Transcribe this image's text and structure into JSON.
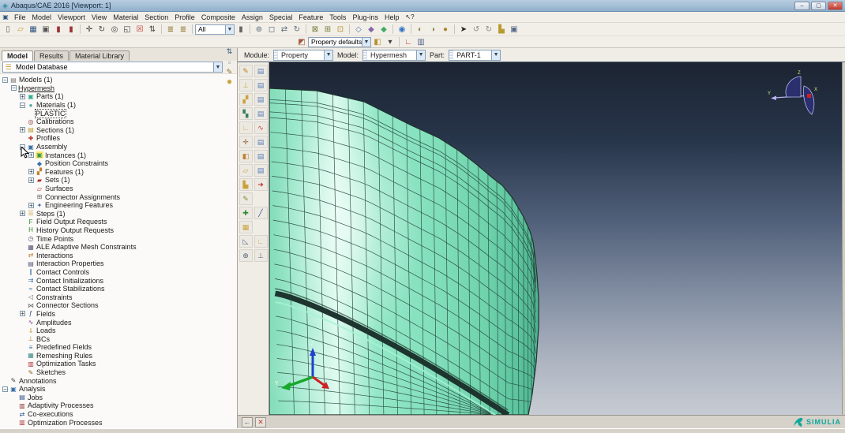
{
  "window": {
    "title": "Abaqus/CAE 2016 [Viewport: 1]",
    "controls": [
      {
        "n": "minimize-button",
        "g": "–"
      },
      {
        "n": "restore-button",
        "g": "▢"
      },
      {
        "n": "close-button",
        "g": "✕"
      }
    ]
  },
  "menu": {
    "items": [
      "File",
      "Model",
      "Viewport",
      "View",
      "Material",
      "Section",
      "Profile",
      "Composite",
      "Assign",
      "Special",
      "Feature",
      "Tools",
      "Plug-ins",
      "Help"
    ],
    "context_help_glyph": "↖?"
  },
  "toolbar_main": {
    "selection_filter_value": "All",
    "icons": [
      {
        "t": "i",
        "n": "new-file-icon",
        "g": "▯",
        "c": "#6b6b6b"
      },
      {
        "t": "i",
        "n": "open-folder-icon",
        "g": "▱",
        "c": "#c8973a"
      },
      {
        "t": "i",
        "n": "save-icon",
        "g": "▦",
        "c": "#33567f"
      },
      {
        "t": "i",
        "n": "print-icon",
        "g": "▣",
        "c": "#555555"
      },
      {
        "t": "i",
        "n": "red-stamp-icon-1",
        "g": "▮",
        "c": "#9c3333"
      },
      {
        "t": "i",
        "n": "red-stamp-icon-2",
        "g": "▮",
        "c": "#9c3333"
      },
      {
        "t": "s"
      },
      {
        "t": "i",
        "n": "pan-view-icon",
        "g": "✛",
        "c": "#444444"
      },
      {
        "t": "i",
        "n": "rotate-view-icon",
        "g": "↻",
        "c": "#444444"
      },
      {
        "t": "i",
        "n": "magnify-view-icon",
        "g": "◎",
        "c": "#444444"
      },
      {
        "t": "i",
        "n": "box-zoom-icon",
        "g": "◱",
        "c": "#444444"
      },
      {
        "t": "i",
        "n": "fit-view-icon",
        "g": "☒",
        "c": "#c23b2f"
      },
      {
        "t": "i",
        "n": "cycle-views-icon",
        "g": "⇅",
        "c": "#444444"
      },
      {
        "t": "s"
      },
      {
        "t": "i",
        "n": "measure-icon-1",
        "g": "≣",
        "c": "#8a6a22"
      },
      {
        "t": "i",
        "n": "measure-icon-2",
        "g": "≣",
        "c": "#8a6a22"
      },
      {
        "t": "s"
      },
      {
        "t": "c",
        "n": "selection-filter-combo",
        "p": "toolbar_main.selection_filter_value",
        "w": 50
      },
      {
        "t": "i",
        "n": "selection-options-icon",
        "g": "▮",
        "c": "#666666"
      },
      {
        "t": "s"
      },
      {
        "t": "i",
        "n": "group-circle-icon",
        "g": "⊚",
        "c": "#5a6a7a"
      },
      {
        "t": "i",
        "n": "outline-box-icon",
        "g": "◻",
        "c": "#5a6a7a"
      },
      {
        "t": "i",
        "n": "translate-tool-icon",
        "g": "⇄",
        "c": "#5a6a7a"
      },
      {
        "t": "i",
        "n": "rotate-tool-icon",
        "g": "↻",
        "c": "#5a6a7a"
      },
      {
        "t": "s"
      },
      {
        "t": "i",
        "n": "wireframe-render-icon",
        "g": "⊠",
        "c": "#7a7a33"
      },
      {
        "t": "i",
        "n": "hidden-render-icon",
        "g": "⊞",
        "c": "#7a7a33"
      },
      {
        "t": "i",
        "n": "shaded-render-icon",
        "g": "⊡",
        "c": "#b8912f"
      },
      {
        "t": "s"
      },
      {
        "t": "i",
        "n": "wire-cube-icon",
        "g": "◇",
        "c": "#5577aa"
      },
      {
        "t": "i",
        "n": "hidden-cube-icon",
        "g": "◆",
        "c": "#8866aa"
      },
      {
        "t": "i",
        "n": "shaded-cube-icon",
        "g": "◆",
        "c": "#44aa66"
      },
      {
        "t": "s"
      },
      {
        "t": "i",
        "n": "info-icon",
        "g": "◉",
        "c": "#2e6fc0"
      },
      {
        "t": "s"
      },
      {
        "t": "i",
        "n": "view-cut-icon-1",
        "g": "◐",
        "c": "#998844"
      },
      {
        "t": "i",
        "n": "view-cut-icon-2",
        "g": "◑",
        "c": "#998844"
      },
      {
        "t": "i",
        "n": "sphere-icon",
        "g": "●",
        "c": "#aa8833"
      },
      {
        "t": "s"
      },
      {
        "t": "i",
        "n": "pointer-icon",
        "g": "➤",
        "c": "#222222"
      },
      {
        "t": "i",
        "n": "undo-icon",
        "g": "↺",
        "c": "#888888"
      },
      {
        "t": "i",
        "n": "redo-icon",
        "g": "↻",
        "c": "#888888"
      },
      {
        "t": "i",
        "n": "datum-corner-icon",
        "g": "▙",
        "c": "#b89a2f"
      },
      {
        "t": "i",
        "n": "viewport-window-icon",
        "g": "▣",
        "c": "#556688"
      }
    ]
  },
  "toolbar_secondary": {
    "color_code_value": "Property defaults",
    "icons": [
      {
        "t": "i",
        "n": "color-code-palette-icon",
        "g": "◩",
        "c": "#a05a3a"
      },
      {
        "t": "c",
        "n": "color-code-combo",
        "p": "toolbar_secondary.color_code_value",
        "w": 80
      },
      {
        "t": "i",
        "n": "color-cube-icon",
        "g": "◧",
        "c": "#b8912f"
      },
      {
        "t": "i",
        "n": "color-cube-dropdown-icon",
        "g": "▾",
        "c": "#444444"
      },
      {
        "t": "s"
      },
      {
        "t": "i",
        "n": "datum-axes-icon",
        "g": "∟",
        "c": "#c23b2f"
      },
      {
        "t": "i",
        "n": "view-options-icon",
        "g": "▥",
        "c": "#556688"
      }
    ]
  },
  "context_bar": {
    "module_label": "Module:",
    "module_value": "Property",
    "model_label": "Model:",
    "model_value": "Hypermesh",
    "part_label": "Part:",
    "part_value": "PART-1"
  },
  "left_panel": {
    "tabs": [
      {
        "label": "Model"
      },
      {
        "label": "Results"
      },
      {
        "label": "Material Library"
      }
    ],
    "database_combo_value": "Model Database",
    "db_buttons": [
      {
        "n": "expand-tree-icon",
        "g": "⇅",
        "c": "#33567f"
      },
      {
        "n": "filter-box-icon",
        "g": "▫",
        "c": "#777777"
      },
      {
        "n": "edit-pencil-icon",
        "g": "✎",
        "c": "#8a6a22"
      },
      {
        "n": "tips-icon",
        "g": "✹",
        "c": "#caa23a"
      }
    ],
    "tree": [
      {
        "l": "Models (1)",
        "d": 0,
        "e": "-",
        "g": "▤",
        "c": "#7a7a7a",
        "n": "models"
      },
      {
        "l": "Hypermesh",
        "d": 1,
        "e": "-",
        "g": "",
        "c": "",
        "n": "model-hypermesh",
        "f": "u"
      },
      {
        "l": "Parts (1)",
        "d": 2,
        "e": "+",
        "g": "▣",
        "c": "#2fa98c",
        "n": "parts"
      },
      {
        "l": "Materials (1)",
        "d": 2,
        "e": "-",
        "g": "●",
        "c": "#4aa8a0",
        "n": "materials"
      },
      {
        "l": "PLASTIC",
        "d": 3,
        "e": "",
        "g": "",
        "c": "",
        "n": "material-plastic",
        "f": "s"
      },
      {
        "l": "Calibrations",
        "d": 2,
        "e": "",
        "g": "◎",
        "c": "#8a2f2f",
        "n": "calibrations"
      },
      {
        "l": "Sections (1)",
        "d": 2,
        "e": "+",
        "g": "▤",
        "c": "#c2992f",
        "n": "sections"
      },
      {
        "l": "Profiles",
        "d": 2,
        "e": "",
        "g": "✚",
        "c": "#c0392b",
        "n": "profiles"
      },
      {
        "l": "Assembly",
        "d": 2,
        "e": "-",
        "g": "▣",
        "c": "#3a6fa8",
        "n": "assembly"
      },
      {
        "l": "Instances (1)",
        "d": 3,
        "e": "+",
        "g": "▣",
        "c": "#2f9a4f",
        "n": "instances",
        "f": "h"
      },
      {
        "l": "Position Constraints",
        "d": 3,
        "e": "",
        "g": "◆",
        "c": "#3a6fa8",
        "n": "position-constraints"
      },
      {
        "l": "Features (1)",
        "d": 3,
        "e": "+",
        "g": "▞",
        "c": "#c07f2f",
        "n": "features"
      },
      {
        "l": "Sets (1)",
        "d": 3,
        "e": "+",
        "g": "▰",
        "c": "#b03030",
        "n": "sets"
      },
      {
        "l": "Surfaces",
        "d": 3,
        "e": "",
        "g": "▱",
        "c": "#b03030",
        "n": "surfaces"
      },
      {
        "l": "Connector Assignments",
        "d": 3,
        "e": "",
        "g": "⊞",
        "c": "#666666",
        "n": "connector-assignments"
      },
      {
        "l": "Engineering Features",
        "d": 3,
        "e": "+",
        "g": "✦",
        "c": "#3a6fa8",
        "n": "engineering-features"
      },
      {
        "l": "Steps (1)",
        "d": 2,
        "e": "+",
        "g": "☰",
        "c": "#caa23a",
        "n": "steps"
      },
      {
        "l": "Field Output Requests",
        "d": 2,
        "e": "",
        "g": "F",
        "c": "#2f8a2f",
        "n": "field-output-requests"
      },
      {
        "l": "History Output Requests",
        "d": 2,
        "e": "",
        "g": "H",
        "c": "#2f8a2f",
        "n": "history-output-requests"
      },
      {
        "l": "Time Points",
        "d": 2,
        "e": "",
        "g": "◷",
        "c": "#555577",
        "n": "time-points"
      },
      {
        "l": "ALE Adaptive Mesh Constraints",
        "d": 2,
        "e": "",
        "g": "▦",
        "c": "#555577",
        "n": "ale-adaptive-mesh-constraints"
      },
      {
        "l": "Interactions",
        "d": 2,
        "e": "",
        "g": "⇄",
        "c": "#c07f2f",
        "n": "interactions"
      },
      {
        "l": "Interaction Properties",
        "d": 2,
        "e": "",
        "g": "▤",
        "c": "#555577",
        "n": "interaction-properties"
      },
      {
        "l": "Contact Controls",
        "d": 2,
        "e": "",
        "g": "∥",
        "c": "#3a6fa8",
        "n": "contact-controls"
      },
      {
        "l": "Contact Initializations",
        "d": 2,
        "e": "",
        "g": "⇉",
        "c": "#3a6fa8",
        "n": "contact-initializations"
      },
      {
        "l": "Contact Stabilizations",
        "d": 2,
        "e": "",
        "g": "≈",
        "c": "#3a6fa8",
        "n": "contact-stabilizations"
      },
      {
        "l": "Constraints",
        "d": 2,
        "e": "",
        "g": "◁",
        "c": "#666666",
        "n": "constraints"
      },
      {
        "l": "Connector Sections",
        "d": 2,
        "e": "",
        "g": "⋈",
        "c": "#666666",
        "n": "connector-sections"
      },
      {
        "l": "Fields",
        "d": 2,
        "e": "+",
        "g": "ƒ",
        "c": "#2f4f8a",
        "n": "fields"
      },
      {
        "l": "Amplitudes",
        "d": 2,
        "e": "",
        "g": "∿",
        "c": "#7a3a8a",
        "n": "amplitudes"
      },
      {
        "l": "Loads",
        "d": 2,
        "e": "",
        "g": "⇓",
        "c": "#caa23a",
        "n": "loads"
      },
      {
        "l": "BCs",
        "d": 2,
        "e": "",
        "g": "⊥",
        "c": "#c07f2f",
        "n": "bcs"
      },
      {
        "l": "Predefined Fields",
        "d": 2,
        "e": "",
        "g": "≡",
        "c": "#3a6fa8",
        "n": "predefined-fields"
      },
      {
        "l": "Remeshing Rules",
        "d": 2,
        "e": "",
        "g": "▦",
        "c": "#3a8a8a",
        "n": "remeshing-rules"
      },
      {
        "l": "Optimization Tasks",
        "d": 2,
        "e": "",
        "g": "▥",
        "c": "#b03030",
        "n": "optimization-tasks"
      },
      {
        "l": "Sketches",
        "d": 2,
        "e": "",
        "g": "✎",
        "c": "#8a6a22",
        "n": "sketches"
      },
      {
        "l": "Annotations",
        "d": 0,
        "e": "",
        "g": "✎",
        "c": "#444444",
        "n": "annotations"
      },
      {
        "l": "Analysis",
        "d": 0,
        "e": "-",
        "g": "▣",
        "c": "#3a6fa8",
        "n": "analysis"
      },
      {
        "l": "Jobs",
        "d": 1,
        "e": "",
        "g": "▤",
        "c": "#2f4f8a",
        "n": "jobs"
      },
      {
        "l": "Adaptivity Processes",
        "d": 1,
        "e": "",
        "g": "▥",
        "c": "#8a2f2f",
        "n": "adaptivity-processes"
      },
      {
        "l": "Co-executions",
        "d": 1,
        "e": "",
        "g": "⇄",
        "c": "#2f4f8a",
        "n": "co-executions"
      },
      {
        "l": "Optimization Processes",
        "d": 1,
        "e": "",
        "g": "▥",
        "c": "#b03030",
        "n": "optimization-processes"
      }
    ]
  },
  "toolbox": {
    "icons": [
      {
        "n": "create-material-icon",
        "g": "✎",
        "c": "#b8860b"
      },
      {
        "n": "material-manager-icon",
        "g": "▤",
        "c": "#5a7fb5"
      },
      {
        "n": "create-section-icon",
        "g": "⊥",
        "c": "#caa23a"
      },
      {
        "n": "section-manager-icon",
        "g": "▤",
        "c": "#5a7fb5"
      },
      {
        "n": "assign-section-icon",
        "g": "▞",
        "c": "#caa23a"
      },
      {
        "n": "assignment-manager-icon",
        "g": "▤",
        "c": "#5a7fb5"
      },
      {
        "n": "composite-layup-icon",
        "g": "▚",
        "c": "#3a7f5a"
      },
      {
        "n": "layup-manager-icon",
        "g": "▤",
        "c": "#5a7fb5"
      },
      {
        "n": "beam-orientation-icon",
        "g": "∟",
        "c": "#caa23a"
      },
      {
        "n": "material-calibration-icon",
        "g": "∿",
        "c": "#c0392b"
      },
      {
        "n": "create-profile-icon",
        "g": "✛",
        "c": "#8a5a2f"
      },
      {
        "n": "profile-manager-icon",
        "g": "▤",
        "c": "#5a7fb5"
      },
      {
        "n": "material-orientation-icon",
        "g": "◧",
        "c": "#c07f2f"
      },
      {
        "n": "orientation-manager-icon",
        "g": "▤",
        "c": "#5a7fb5"
      },
      {
        "n": "create-shell-icon",
        "g": "▱",
        "c": "#caa23a"
      },
      {
        "n": "shell-manager-icon",
        "g": "▤",
        "c": "#5a7fb5"
      },
      {
        "n": "assign-thickness-icon",
        "g": "▙",
        "c": "#caa23a"
      },
      {
        "n": "assign-arrow-icon",
        "g": "➜",
        "c": "#c0392b"
      },
      {
        "n": "create-skin-icon",
        "g": "✎",
        "c": "#8a8a2f"
      },
      {
        "b": true
      },
      {
        "n": "create-datum-icon",
        "g": "✚",
        "c": "#2f8a2f"
      },
      {
        "n": "query-pipette-icon",
        "g": "╱",
        "c": "#2f4f8a"
      },
      {
        "n": "seed-mesh-icon",
        "g": "▦",
        "c": "#caa23a"
      },
      {
        "b": true
      },
      {
        "n": "select-tool-icon-a",
        "g": "◺",
        "c": "#556677"
      },
      {
        "n": "select-tool-icon-b",
        "g": "∟",
        "c": "#caa23a"
      },
      {
        "n": "coordinate-tool-icon",
        "g": "⊕",
        "c": "#556677"
      },
      {
        "n": "triad-tool-icon",
        "g": "⊥",
        "c": "#556677"
      }
    ]
  },
  "viewport": {
    "bg_top": "#1c2432",
    "bg_bottom": "#c7cbd3",
    "mesh_color": "#8debc8",
    "mesh_line_color": "#23443b",
    "origin_triad": {
      "x": "X",
      "y": "Y",
      "z": "Z"
    },
    "compass": {
      "x": "X",
      "y": "Y",
      "z": "Z"
    },
    "logo_text": "SIMULIA"
  },
  "prompt_area": {
    "back_glyph": "←",
    "cancel_glyph": "✕"
  }
}
